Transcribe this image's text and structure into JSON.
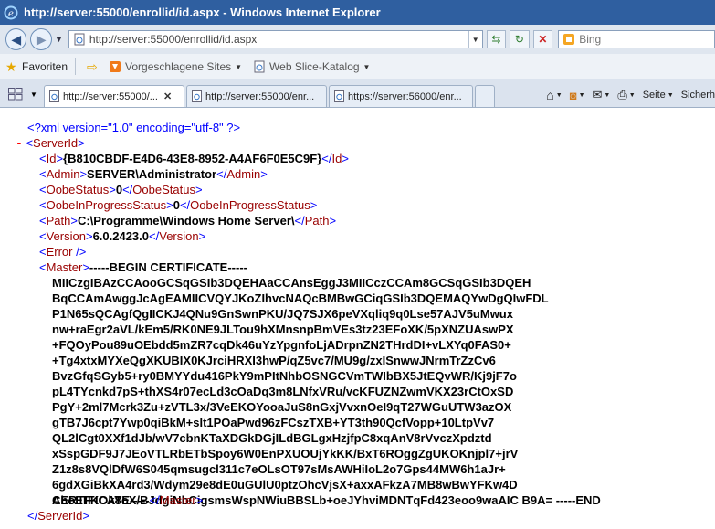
{
  "window": {
    "title": "http://server:55000/enrollid/id.aspx - Windows Internet Explorer"
  },
  "address_bar": {
    "url": "http://server:55000/enrollid/id.aspx"
  },
  "search": {
    "placeholder": "Bing"
  },
  "favorites_bar": {
    "favorites_label": "Favoriten",
    "suggested_sites": "Vorgeschlagene Sites",
    "web_slice_gallery": "Web Slice-Katalog"
  },
  "tabs": [
    {
      "label": "http://server:55000/...",
      "active": true
    },
    {
      "label": "http://server:55000/enr...",
      "active": false
    },
    {
      "label": "https://server:56000/enr...",
      "active": false
    }
  ],
  "command_bar": {
    "page": "Seite",
    "safety": "Sicherh"
  },
  "xml": {
    "declaration": "<?xml version=\"1.0\" encoding=\"utf-8\" ?>",
    "collapse": "-",
    "root_tag": "ServerId",
    "id": {
      "tag": "Id",
      "value": "{B810CBDF-E4D6-43E8-8952-A4AF6F0E5C9F}"
    },
    "admin": {
      "tag": "Admin",
      "value": "SERVER\\Administrator"
    },
    "oobe_status": {
      "tag": "OobeStatus",
      "value": "0"
    },
    "oobe_in_progress": {
      "tag": "OobeInProgressStatus",
      "value": "0"
    },
    "path": {
      "tag": "Path",
      "value": "C:\\Programme\\Windows Home Server\\"
    },
    "version": {
      "tag": "Version",
      "value": "6.0.2423.0"
    },
    "error": {
      "tag": "Error"
    },
    "master": {
      "tag": "Master",
      "first_line": "-----BEGIN CERTIFICATE-----",
      "lines": [
        "MIICzgIBAzCCAooGCSqGSIb3DQEHAaCCAnsEggJ3MIICczCCAm8GCSqGSIb3DQEH",
        "BqCCAmAwggJcAgEAMIICVQYJKoZIhvcNAQcBMBwGCiqGSIb3DQEMAQYwDgQIwFDL",
        "P1N65sQCAgfQgIICKJ4QNu9GnSwnPKU/JQ7SJX6peVXqliq9q0Lse57AJV5uMwux",
        "nw+raEgr2aVL/kEm5/RK0NE9JLTou9hXMnsnpBmVEs3tz23EFoXK/5pXNZUAswPX",
        "+FQOyPou89uOEbdd5mZR7cqDk46uYzYpgnfoLjADrpnZN2THrdDI+vLXYq0FAS0+",
        "+Tg4xtxMYXeQgXKUBIX0KJrciHRXI3hwP/qZ5vc7/MU9g/zxISnwwJNrmTrZzCv6",
        "BvzGfqSGyb5+ry0BMYYdu416PkY9mPItNhbOSNGCVmTWIbBX5JtEQvWR/Kj9jF7o",
        "pL4TYcnkd7pS+thXS4r07ecLd3cOaDq3m8LNfxVRu/vcKFUZNZwmVKX23rCtOxSD",
        "PgY+2ml7Mcrk3Zu+zVTL3x/3VeEKOYooaJuS8nGxjVvxnOeI9qT27WGuUTW3azOX",
        "gTB7J6cpt7Ywp0qiBkM+slt1POaPwd96zFCszTXB+YT3th90QcfVopp+10LtpVv7",
        "QL2lCgt0XXf1dJb/wV7cbnKTaXDGkDGjILdBGLgxHzjfpC8xqAnV8rVvczXpdztd",
        "xSspGDF9J7JEoVTLRbETbSpoy6W0EnPXUOUjYkKK/BxT6ROggZgUKOKnjpl7+jrV",
        "Z1z8s8VQlDfW6S045qmsugcl311c7eOLsOT97sMsAWHiIoL2o7Gps44MW6h1aJr+",
        "6gdXGiBkXA4rd3/Wdym29e8dE0uGUlU0ptzOhcVjsX+axxAFkzA7MB8wBwYFKw4D",
        "AhoEFKOk8oX/BJdgiNbCigsmsWspNWiuBBSLb+oeJYhviMDNTqFd423eoo9waAIC B9A= -----END"
      ],
      "last_line": "CERTIFICATE-----"
    }
  }
}
